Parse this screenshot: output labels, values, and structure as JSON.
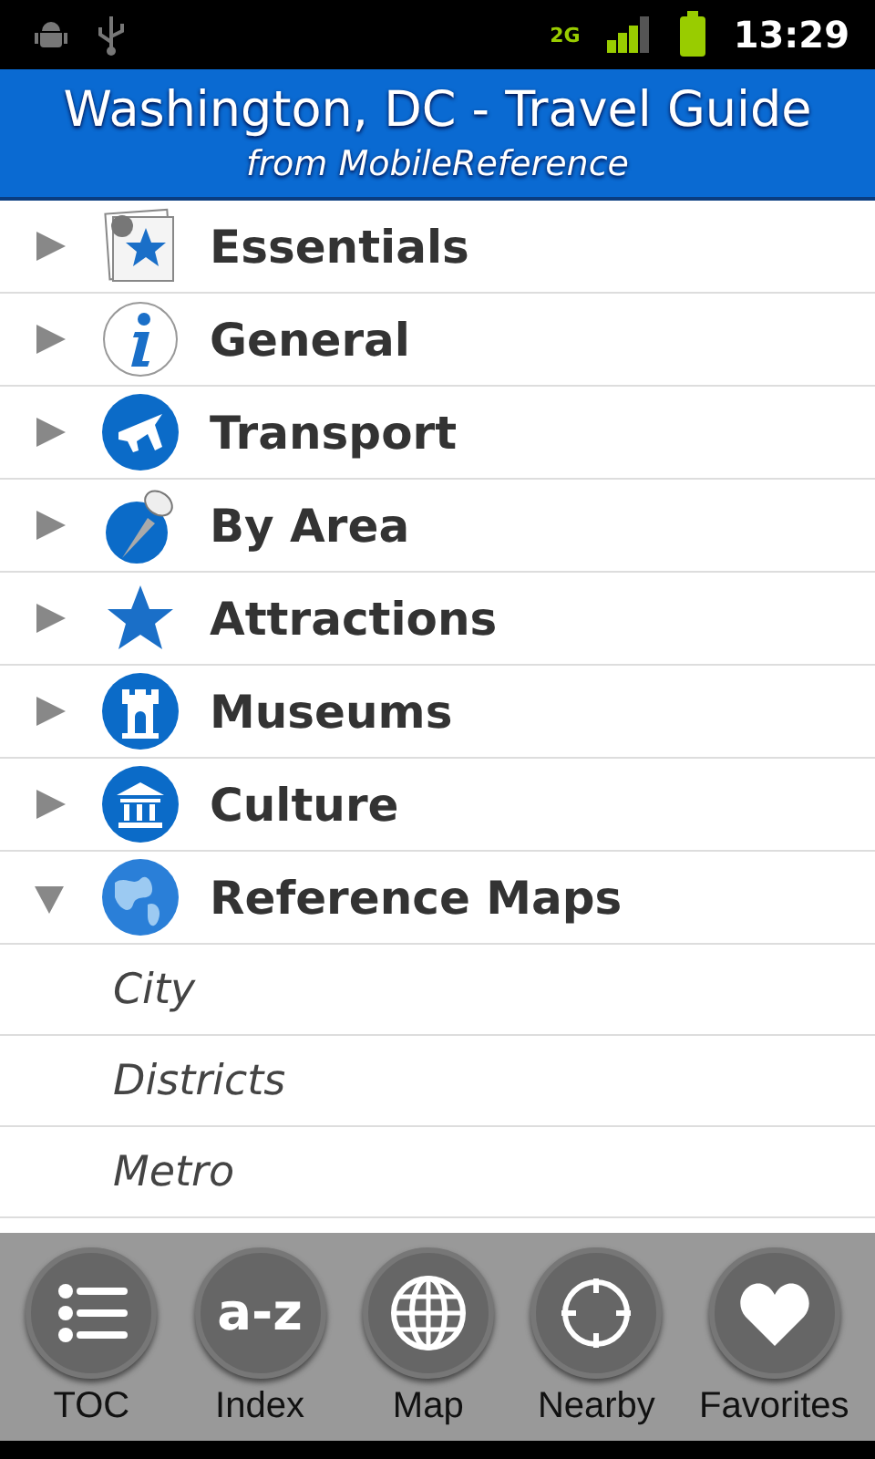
{
  "status_bar": {
    "network": "2G",
    "time": "13:29"
  },
  "header": {
    "title": "Washington, DC - Travel Guide",
    "subtitle": "from MobileReference"
  },
  "toc": [
    {
      "label": "Essentials",
      "expanded": false
    },
    {
      "label": "General",
      "expanded": false
    },
    {
      "label": "Transport",
      "expanded": false
    },
    {
      "label": "By Area",
      "expanded": false
    },
    {
      "label": "Attractions",
      "expanded": false
    },
    {
      "label": "Museums",
      "expanded": false
    },
    {
      "label": "Culture",
      "expanded": false
    },
    {
      "label": "Reference Maps",
      "expanded": true,
      "children": [
        {
          "label": "City"
        },
        {
          "label": "Districts"
        },
        {
          "label": "Metro"
        }
      ]
    }
  ],
  "toolbar": [
    {
      "label": "TOC"
    },
    {
      "label": "Index",
      "icon_text": "a-z"
    },
    {
      "label": "Map"
    },
    {
      "label": "Nearby"
    },
    {
      "label": "Favorites"
    }
  ]
}
